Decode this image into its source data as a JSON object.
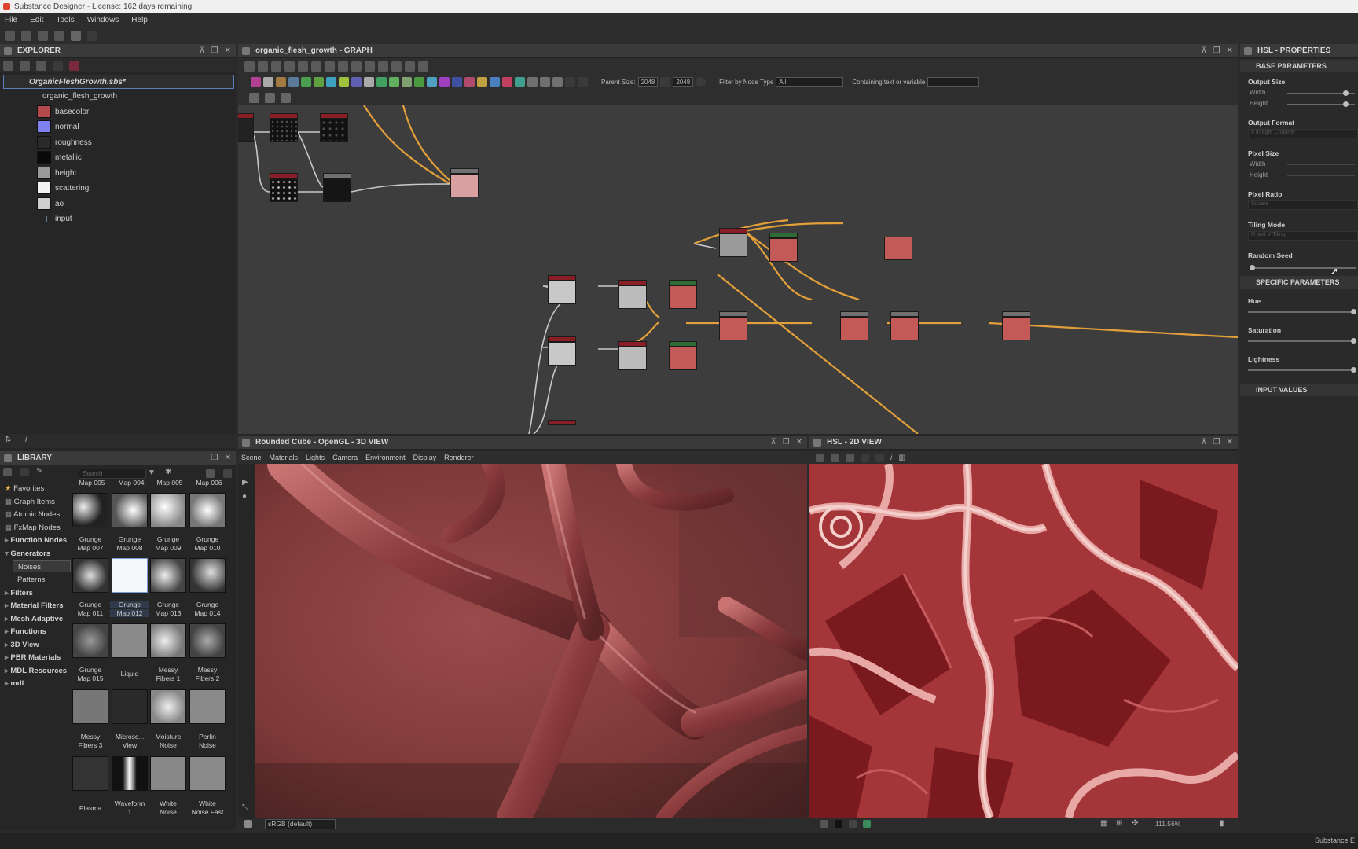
{
  "window": {
    "title": "Substance Designer - License: 162 days remaining"
  },
  "menu": [
    "File",
    "Edit",
    "Tools",
    "Windows",
    "Help"
  ],
  "explorer": {
    "title": "EXPLORER",
    "package": "OrganicFleshGrowth.sbs*",
    "graph": "organic_flesh_growth",
    "outputs": [
      {
        "label": "basecolor",
        "color": "#b34a4d"
      },
      {
        "label": "normal",
        "color": "#8080ee"
      },
      {
        "label": "roughness",
        "color": "#2a2a2a"
      },
      {
        "label": "metallic",
        "color": "#0a0a0a"
      },
      {
        "label": "height",
        "color": "#9a9a9a"
      },
      {
        "label": "scattering",
        "color": "#f2f2f2"
      },
      {
        "label": "ao",
        "color": "#cfcfcf"
      }
    ],
    "input": "input"
  },
  "graph": {
    "title": "organic_flesh_growth - GRAPH",
    "parent_size_label": "Parent Size:",
    "parent_size": "2048",
    "size2": "2048",
    "filter_label": "Filter by Node Type",
    "filter_value": "All",
    "containing_label": "Containing text or variable"
  },
  "properties": {
    "title": "HSL - PROPERTIES",
    "base_section": "BASE PARAMETERS",
    "output_size": "Output Size",
    "width": "Width",
    "height": "Height",
    "output_format": "Output Format",
    "output_format_value": "8 Integer Channel",
    "pixel_size": "Pixel Size",
    "pixel_ratio": "Pixel Ratio",
    "pixel_ratio_value": "Square",
    "tiling_mode": "Tiling Mode",
    "tiling_mode_value": "H and V Tiling",
    "random_seed": "Random Seed",
    "specific_section": "SPECIFIC PARAMETERS",
    "hue": "Hue",
    "saturation": "Saturation",
    "lightness": "Lightness",
    "input_values": "INPUT VALUES"
  },
  "library": {
    "title": "LIBRARY",
    "search_placeholder": "Search",
    "categories": [
      "Favorites",
      "Graph Items",
      "Atomic Nodes",
      "FxMap Nodes",
      "Function Nodes",
      "Generators",
      "Noises",
      "Patterns",
      "Filters",
      "Material Filters",
      "Mesh Adaptive",
      "Functions",
      "3D View",
      "PBR Materials",
      "MDL Resources",
      "mdl"
    ],
    "top_partial": [
      "Map 005",
      "Map 004",
      "Map 005",
      "Map 006"
    ],
    "rows": [
      [
        {
          "l1": "Grunge",
          "l2": "Map 007"
        },
        {
          "l1": "Grunge",
          "l2": "Map 008"
        },
        {
          "l1": "Grunge",
          "l2": "Map 009"
        },
        {
          "l1": "Grunge",
          "l2": "Map 010"
        }
      ],
      [
        {
          "l1": "Grunge",
          "l2": "Map 011"
        },
        {
          "l1": "Grunge",
          "l2": "Map 012"
        },
        {
          "l1": "Grunge",
          "l2": "Map 013"
        },
        {
          "l1": "Grunge",
          "l2": "Map 014"
        }
      ],
      [
        {
          "l1": "Grunge",
          "l2": "Map 015"
        },
        {
          "l1": "Liquid",
          "l2": ""
        },
        {
          "l1": "Messy",
          "l2": "Fibers 1"
        },
        {
          "l1": "Messy",
          "l2": "Fibers 2"
        }
      ],
      [
        {
          "l1": "Messy",
          "l2": "Fibers 3"
        },
        {
          "l1": "Microsc...",
          "l2": "View"
        },
        {
          "l1": "Moisture",
          "l2": "Noise"
        },
        {
          "l1": "Perlin",
          "l2": "Noise"
        }
      ],
      [
        {
          "l1": "Plasma",
          "l2": ""
        },
        {
          "l1": "Waveform",
          "l2": "1"
        },
        {
          "l1": "White",
          "l2": "Noise"
        },
        {
          "l1": "White",
          "l2": "Noise Fast"
        }
      ]
    ]
  },
  "view3d": {
    "title": "Rounded Cube - OpenGL - 3D VIEW",
    "menu": [
      "Scene",
      "Materials",
      "Lights",
      "Camera",
      "Environment",
      "Display",
      "Renderer"
    ],
    "colorspace": "sRGB (default)"
  },
  "view2d": {
    "title": "HSL - 2D VIEW",
    "zoom": "111.56%"
  },
  "status": {
    "right": "Substance E"
  }
}
